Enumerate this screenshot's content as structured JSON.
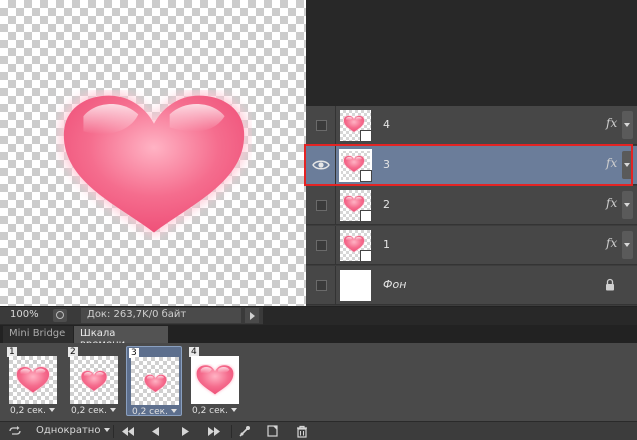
{
  "document": {
    "zoom": "100%",
    "doc_info": "Док: 263,7K/0 байт"
  },
  "layers": [
    {
      "name": "4",
      "visible": false,
      "selected": false,
      "has_fx": true,
      "type": "smart-object"
    },
    {
      "name": "3",
      "visible": true,
      "selected": true,
      "has_fx": true,
      "type": "smart-object"
    },
    {
      "name": "2",
      "visible": false,
      "selected": false,
      "has_fx": true,
      "type": "smart-object"
    },
    {
      "name": "1",
      "visible": false,
      "selected": false,
      "has_fx": true,
      "type": "smart-object"
    },
    {
      "name": "Фон",
      "visible": false,
      "selected": false,
      "has_fx": false,
      "type": "background",
      "locked": true
    }
  ],
  "fx_label": "fx",
  "tabs": [
    {
      "label": "Mini Bridge",
      "active": false
    },
    {
      "label": "Шкала времени",
      "active": true
    }
  ],
  "frames": [
    {
      "number": "1",
      "delay": "0,2 сек.",
      "selected": false
    },
    {
      "number": "2",
      "delay": "0,2 сек.",
      "selected": false
    },
    {
      "number": "3",
      "delay": "0,2 сек.",
      "selected": true
    },
    {
      "number": "4",
      "delay": "0,2 сек.",
      "selected": false
    }
  ],
  "controls": {
    "loop_option": "Однократно",
    "buttons": [
      "first-frame",
      "previous-frame",
      "play",
      "next-frame",
      "tween",
      "duplicate-frame",
      "delete-frame"
    ]
  },
  "colors": {
    "heart_main": "#f56d8e",
    "heart_light": "#ffd6e0",
    "selected_layer": "#6b7d9a",
    "highlight_border": "#e32424"
  }
}
